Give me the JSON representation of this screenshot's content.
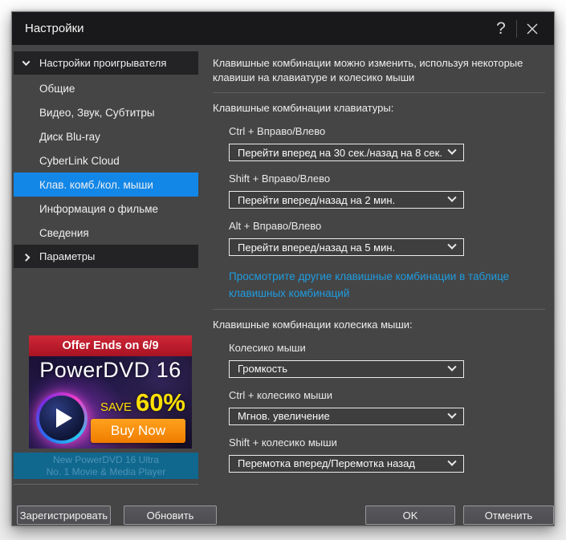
{
  "window": {
    "title": "Настройки"
  },
  "titlebar": {
    "help": "?"
  },
  "sidebar": {
    "group1": "Настройки проигрывателя",
    "items": [
      "Общие",
      "Видео, Звук, Субтитры",
      "Диск Blu-ray",
      "CyberLink Cloud",
      "Клав. комб./кол. мыши",
      "Информация о фильме",
      "Сведения"
    ],
    "selected": "Клав. комб./кол. мыши",
    "group2": "Параметры"
  },
  "main": {
    "description": "Клавишные комбинации можно изменить, используя некоторые клавиши на клавиатуре и колесико мыши",
    "keyboard": {
      "heading": "Клавишные комбинации клавиатуры:",
      "rows": [
        {
          "label": "Ctrl + Вправо/Влево",
          "value": "Перейти вперед на 30 сек./назад на 8 сек."
        },
        {
          "label": "Shift + Вправо/Влево",
          "value": "Перейти вперед/назад на 2 мин."
        },
        {
          "label": "Alt + Вправо/Влево",
          "value": "Перейти вперед/назад на 5 мин."
        }
      ],
      "link": "Просмотрите другие клавишные комбинации в таблице клавишных комбинаций"
    },
    "mouse": {
      "heading": "Клавишные комбинации колесика мыши:",
      "rows": [
        {
          "label": "Колесико мыши",
          "value": "Громкость"
        },
        {
          "label": "Ctrl + колесико мыши",
          "value": "Мгнов. увеличение"
        },
        {
          "label": "Shift + колесико мыши",
          "value": "Перемотка вперед/Перемотка назад"
        }
      ]
    }
  },
  "ad": {
    "offer": "Offer Ends on 6/9",
    "product": "PowerDVD 16",
    "save_word": "SAVE",
    "save_value": "60%",
    "buy": "Buy Now",
    "footer_line1": "New PowerDVD 16 Ultra",
    "footer_line2": "No. 1 Movie & Media Player"
  },
  "buttons": {
    "register": "Зарегистрировать",
    "update": "Обновить",
    "ok": "OK",
    "cancel": "Отменить"
  },
  "colors": {
    "accent_selected": "#1287e8",
    "link": "#1f9ce0",
    "ad_red": "#c1202f",
    "buy_orange": "#ef7c00",
    "ad_footer_teal": "#10688f",
    "titlebar": "#19191b",
    "dialog_bg": "#454545"
  }
}
